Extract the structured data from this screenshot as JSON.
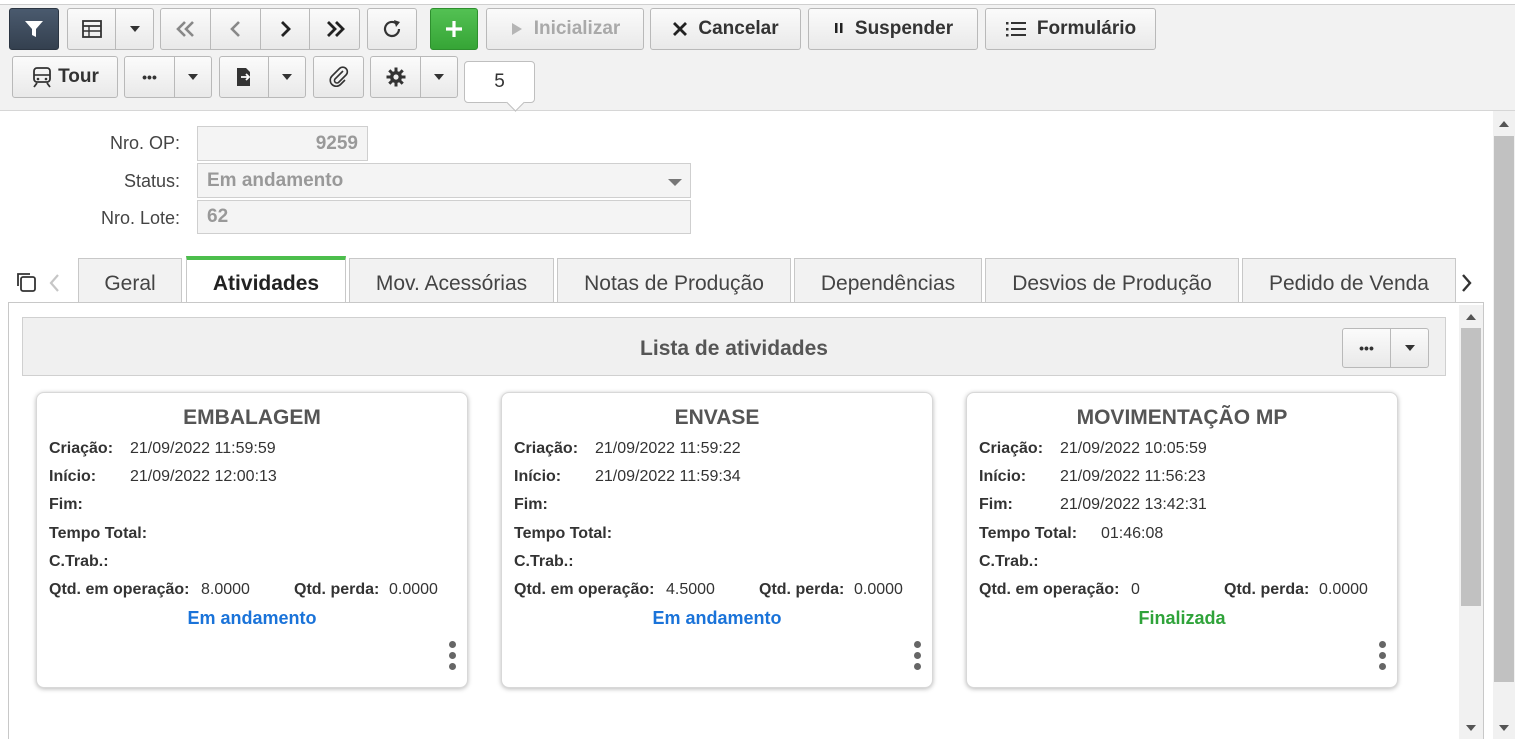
{
  "toolbar": {
    "start_label": "Inicializar",
    "cancel_label": "Cancelar",
    "suspend_label": "Suspender",
    "form_label": "Formulário",
    "tour_label": "Tour",
    "more_label": "•••",
    "record_counter": "5"
  },
  "form": {
    "op_label": "Nro. OP:",
    "op_value": "9259",
    "status_label": "Status:",
    "status_value": "Em andamento",
    "lote_label": "Nro. Lote:",
    "lote_value": "62"
  },
  "tabs": [
    {
      "label": "Geral"
    },
    {
      "label": "Atividades"
    },
    {
      "label": "Mov. Acessórias"
    },
    {
      "label": "Notas de Produção"
    },
    {
      "label": "Dependências"
    },
    {
      "label": "Desvios de Produção"
    },
    {
      "label": "Pedido de Venda"
    }
  ],
  "panel": {
    "title": "Lista de atividades",
    "more_label": "•••"
  },
  "field_labels": {
    "creation": "Criação:",
    "start": "Início:",
    "end": "Fim:",
    "total_time": "Tempo Total:",
    "work_center": "C.Trab.:",
    "qty_in_op": "Qtd. em operação:",
    "qty_loss": "Qtd. perda:"
  },
  "activities": [
    {
      "title": "EMBALAGEM",
      "creation": "21/09/2022 11:59:59",
      "start": "21/09/2022 12:00:13",
      "end": "",
      "total_time": "",
      "work_center": "",
      "qty_in_op": "8.0000",
      "qty_loss": "0.0000",
      "status": "Em andamento",
      "status_color": "#1a73d9"
    },
    {
      "title": "ENVASE",
      "creation": "21/09/2022 11:59:22",
      "start": "21/09/2022 11:59:34",
      "end": "",
      "total_time": "",
      "work_center": "",
      "qty_in_op": "4.5000",
      "qty_loss": "0.0000",
      "status": "Em andamento",
      "status_color": "#1a73d9"
    },
    {
      "title": "MOVIMENTAÇÃO MP",
      "creation": "21/09/2022 10:05:59",
      "start": "21/09/2022 11:56:23",
      "end": "21/09/2022 13:42:31",
      "total_time": "01:46:08",
      "work_center": "",
      "qty_in_op": "0",
      "qty_loss": "0.0000",
      "status": "Finalizada",
      "status_color": "#2fa33a"
    }
  ],
  "colors": {
    "accent_green": "#4cbe4c",
    "filter_dark": "#3b4757"
  }
}
